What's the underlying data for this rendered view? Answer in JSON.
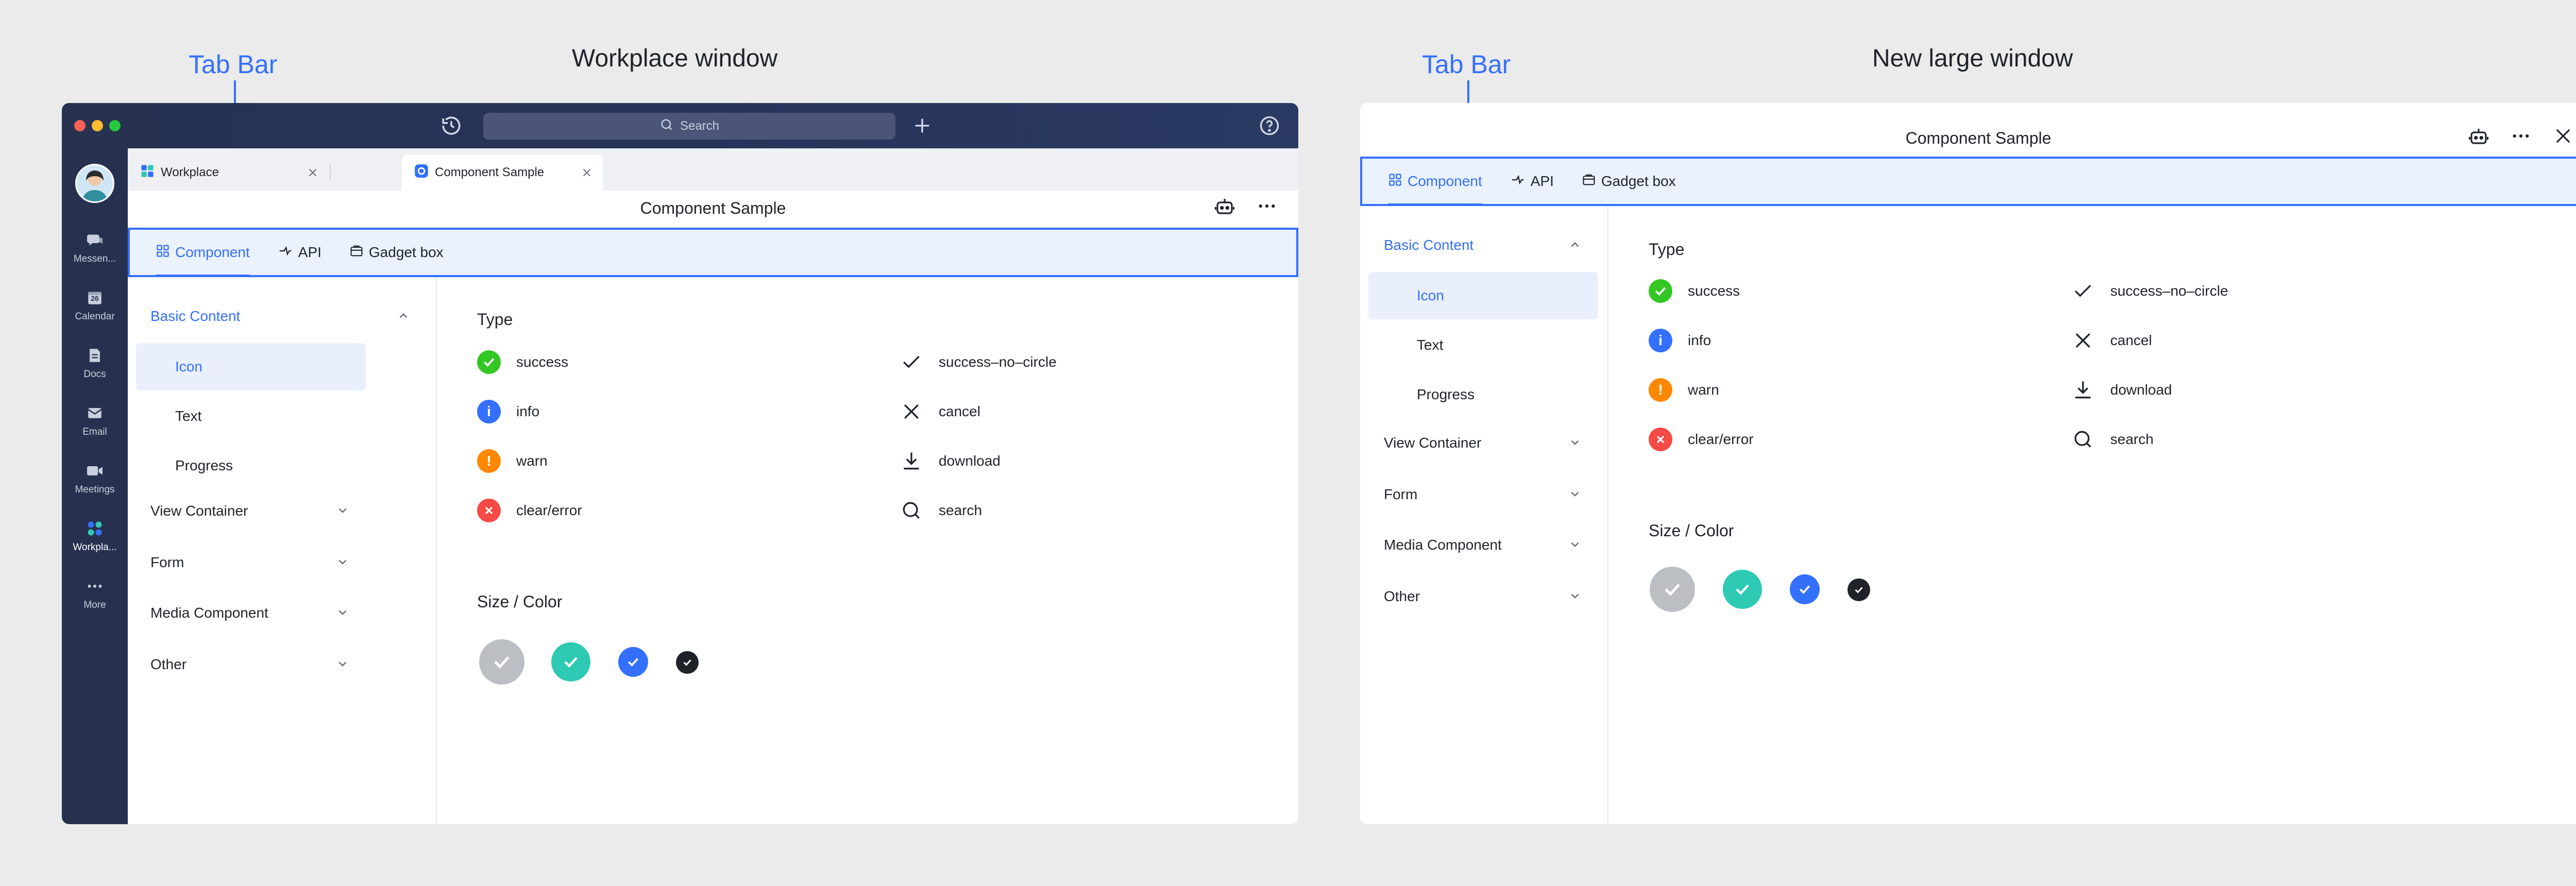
{
  "captions": {
    "workplace_window": "Workplace window",
    "large_window": "New large window",
    "tab_bar": "Tab Bar"
  },
  "colors": {
    "accent": "#3370ff",
    "success": "#34c724",
    "info": "#3370ff",
    "warn": "#ff8800",
    "error": "#f54a45",
    "teal": "#2ec9b3",
    "gray": "#bbbfc4",
    "dark": "#1f2329"
  },
  "workplace": {
    "search_placeholder": "Search",
    "sidebar": [
      {
        "label": "Messen...",
        "icon": "messenger-icon"
      },
      {
        "label": "Calendar",
        "icon": "calendar-icon",
        "badge": "26"
      },
      {
        "label": "Docs",
        "icon": "docs-icon"
      },
      {
        "label": "Email",
        "icon": "email-icon"
      },
      {
        "label": "Meetings",
        "icon": "meetings-icon"
      },
      {
        "label": "Workpla...",
        "icon": "workplace-icon"
      },
      {
        "label": "More",
        "icon": "more-icon"
      }
    ],
    "tabs": [
      {
        "label": "Workplace"
      },
      {
        "label": "Component Sample"
      }
    ]
  },
  "app": {
    "title": "Component Sample",
    "tabbar": [
      "Component",
      "API",
      "Gadget box"
    ],
    "nav": {
      "basic": "Basic Content",
      "sub": [
        "Icon",
        "Text",
        "Progress"
      ],
      "groups": [
        "View Container",
        "Form",
        "Media Component",
        "Other"
      ]
    },
    "type_title": "Type",
    "size_title": "Size / Color",
    "types_left": [
      "success",
      "info",
      "warn",
      "clear/error"
    ],
    "types_right": [
      "success–no–circle",
      "cancel",
      "download",
      "search"
    ]
  }
}
